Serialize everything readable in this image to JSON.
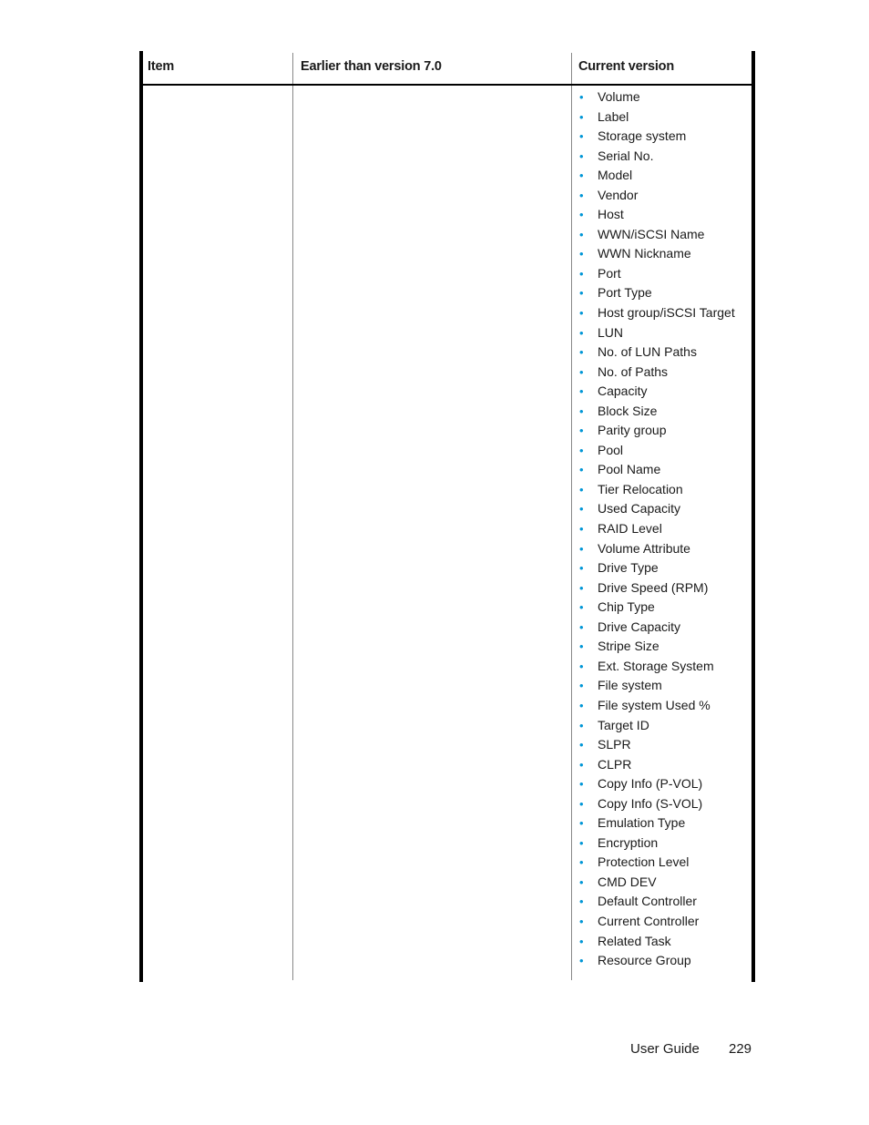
{
  "table": {
    "headers": [
      "Item",
      "Earlier than version 7.0",
      "Current version"
    ],
    "bullet_color": "#0096d6",
    "rows": [
      {
        "item": "",
        "earlier": "",
        "current": [
          "Volume",
          "Label",
          "Storage system",
          "Serial No.",
          "Model",
          "Vendor",
          "Host",
          "WWN/iSCSI Name",
          "WWN Nickname",
          "Port",
          "Port Type",
          "Host group/iSCSI Target",
          "LUN",
          "No. of LUN Paths",
          "No. of Paths",
          "Capacity",
          "Block Size",
          "Parity group",
          "Pool",
          "Pool Name",
          "Tier Relocation",
          "Used Capacity",
          "RAID Level",
          "Volume Attribute",
          "Drive Type",
          "Drive Speed (RPM)",
          "Chip Type",
          "Drive Capacity",
          "Stripe Size",
          "Ext. Storage System",
          "File system",
          "File system Used %",
          "Target ID",
          "SLPR",
          "CLPR",
          "Copy Info (P-VOL)",
          "Copy Info (S-VOL)",
          "Emulation Type",
          "Encryption",
          "Protection Level",
          "CMD DEV",
          "Default Controller",
          "Current Controller",
          "Related Task",
          "Resource Group"
        ]
      }
    ]
  },
  "footer": {
    "doc_title": "User Guide",
    "page_number": "229"
  }
}
